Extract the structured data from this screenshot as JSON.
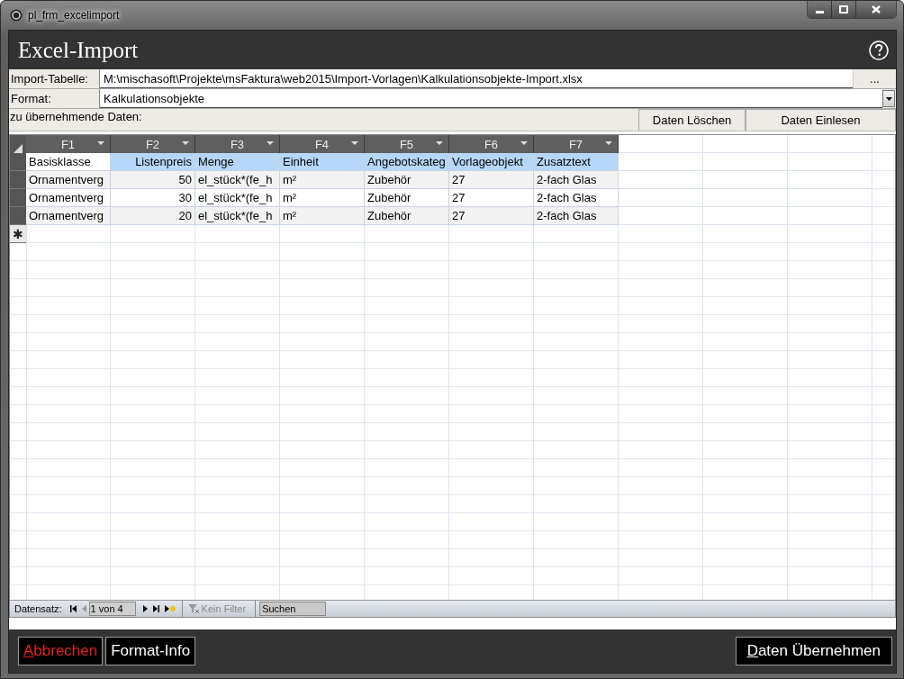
{
  "window": {
    "title": "pl_frm_excelimport"
  },
  "form": {
    "title": "Excel-Import"
  },
  "fields": [
    {
      "label": "Import-Tabelle:",
      "kind": "file",
      "value": "M:\\mischasoft\\Projekte\\msFaktura\\web2015\\Import-Vorlagen\\Kalkulationsobjekte-Import.xlsx",
      "button": "..."
    },
    {
      "label": "Format:",
      "kind": "dropdown",
      "value": "Kalkulationsobjekte"
    }
  ],
  "data_section": {
    "label": "zu übernehmende Daten:",
    "buttons": [
      "Daten Löschen",
      "Daten Einlesen"
    ]
  },
  "table": {
    "columns": [
      {
        "label": "F1",
        "right_aligned": false
      },
      {
        "label": "F2",
        "right_aligned": true
      },
      {
        "label": "F3",
        "right_aligned": false
      },
      {
        "label": "F4",
        "right_aligned": false
      },
      {
        "label": "F5",
        "right_aligned": false
      },
      {
        "label": "F6",
        "right_aligned": false
      },
      {
        "label": "F7",
        "right_aligned": false
      }
    ],
    "rows": [
      {
        "cells": [
          {
            "text": "Basisklasse",
            "selected": false
          },
          {
            "text": "Listenpreis",
            "selected": true
          },
          {
            "text": "Menge",
            "selected": true
          },
          {
            "text": "Einheit",
            "selected": true
          },
          {
            "text": "Angebotskateg",
            "selected": true
          },
          {
            "text": "Vorlageobjekt",
            "selected": true
          },
          {
            "text": "Zusatztext",
            "selected": true
          }
        ]
      },
      {
        "cells": [
          {
            "text": "Ornamentverg",
            "selected": false
          },
          {
            "text": "50",
            "selected": false
          },
          {
            "text": "el_stück*(fe_h",
            "selected": false
          },
          {
            "text": "m²",
            "selected": false
          },
          {
            "text": "Zubehör",
            "selected": false
          },
          {
            "text": "27",
            "selected": false
          },
          {
            "text": "2-fach Glas",
            "selected": false
          }
        ]
      },
      {
        "cells": [
          {
            "text": "Ornamentverg",
            "selected": false
          },
          {
            "text": "30",
            "selected": false
          },
          {
            "text": "el_stück*(fe_h",
            "selected": false
          },
          {
            "text": "m²",
            "selected": false
          },
          {
            "text": "Zubehör",
            "selected": false
          },
          {
            "text": "27",
            "selected": false
          },
          {
            "text": "2-fach Glas",
            "selected": false
          }
        ]
      },
      {
        "cells": [
          {
            "text": "Ornamentverg",
            "selected": false
          },
          {
            "text": "20",
            "selected": false
          },
          {
            "text": "el_stück*(fe_h",
            "selected": false
          },
          {
            "text": "m²",
            "selected": false
          },
          {
            "text": "Zubehör",
            "selected": false
          },
          {
            "text": "27",
            "selected": false
          },
          {
            "text": "2-fach Glas",
            "selected": false
          }
        ]
      }
    ],
    "new_row_marker": "✱"
  },
  "navigation": {
    "label": "Datensatz:",
    "position": "1 von 4",
    "filter": "Kein Filter",
    "search_placeholder": "Suchen"
  },
  "footer_buttons": [
    {
      "label": "Abbrechen",
      "kind": "cancel",
      "access_key": true
    },
    {
      "label": "Format-Info",
      "kind": "normal",
      "access_key": false
    },
    {
      "label": "Daten Übernehmen",
      "kind": "normal",
      "access_key": true
    }
  ]
}
